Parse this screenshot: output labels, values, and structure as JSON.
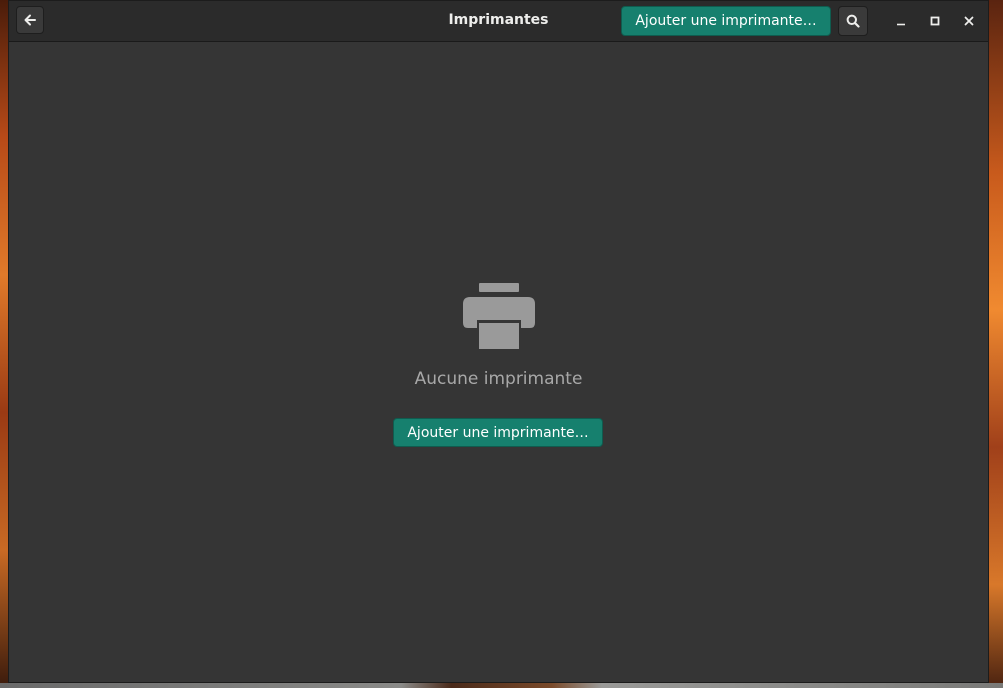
{
  "window": {
    "title": "Imprimantes"
  },
  "header": {
    "back_icon": "arrow-left-icon",
    "add_printer_label": "Ajouter une imprimante…",
    "search_icon": "search-icon",
    "minimize_icon": "minimize-icon",
    "maximize_icon": "maximize-icon",
    "close_icon": "close-icon"
  },
  "empty_state": {
    "icon": "printer-icon",
    "message": "Aucune imprimante",
    "add_printer_label": "Ajouter une imprimante…"
  },
  "colors": {
    "accent": "#16806e",
    "window_bg": "#353535",
    "headerbar_bg": "#2b2b2b",
    "icon_gray": "#9a9a9a"
  }
}
